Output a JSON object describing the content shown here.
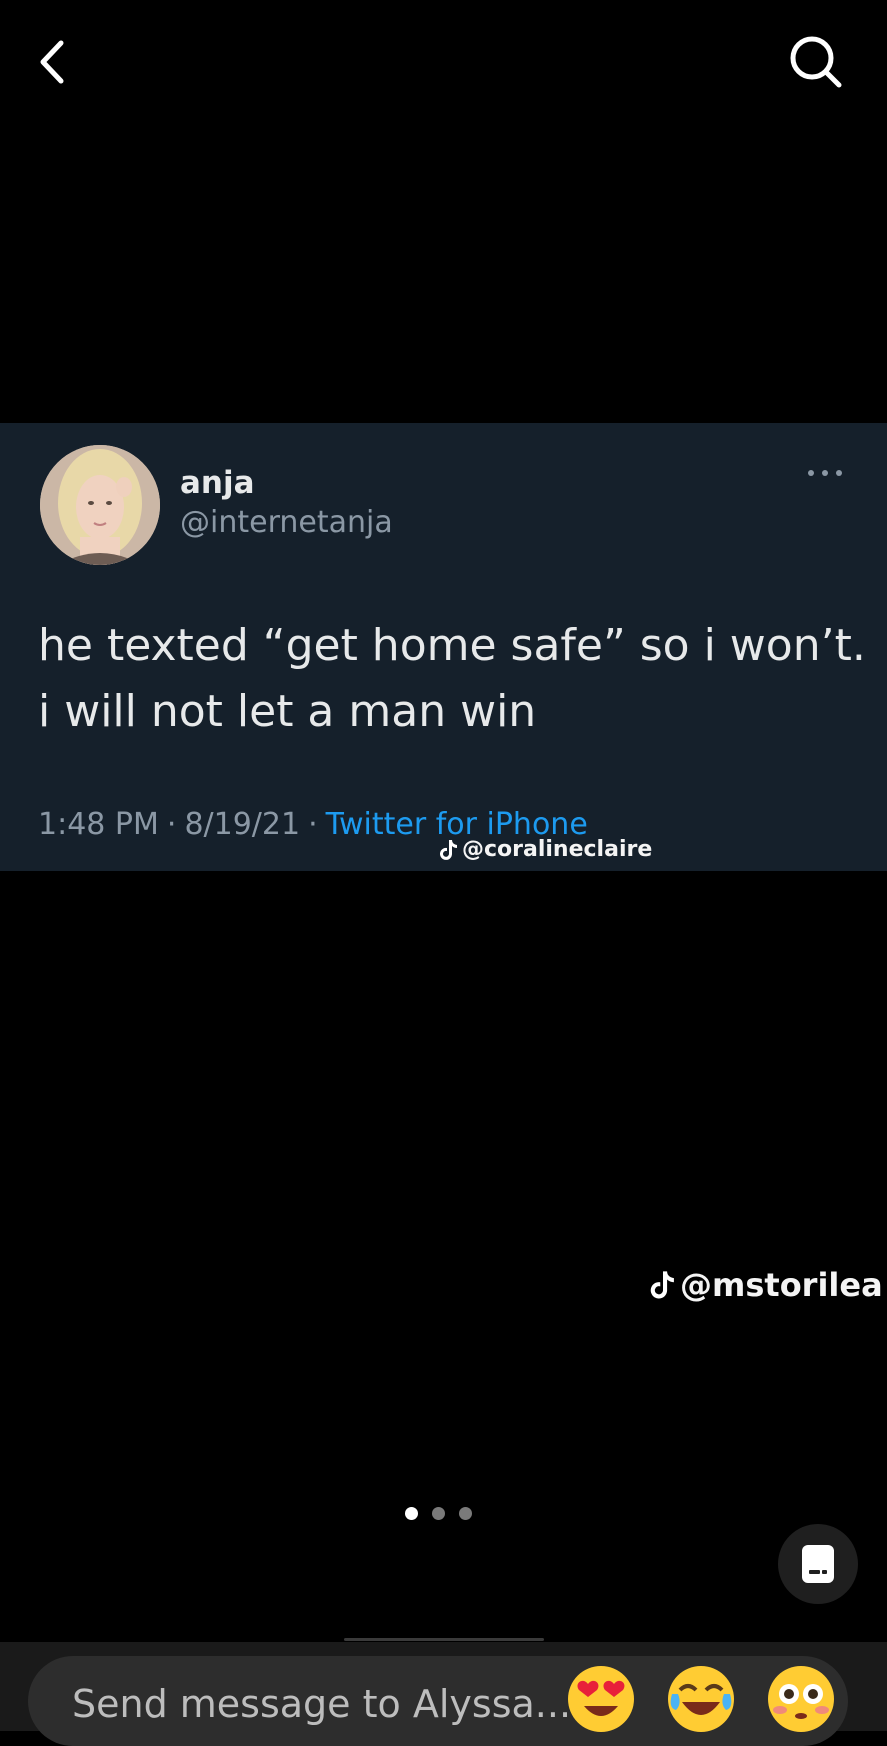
{
  "colors": {
    "background": "#000000",
    "tweet_background": "#15202b",
    "tweet_text": "#e7e9ea",
    "tweet_muted": "#8b98a5",
    "twitter_link": "#1d9bf0"
  },
  "nav": {
    "back_icon": "chevron-left-icon",
    "search_icon": "search-icon"
  },
  "tweet": {
    "name": "anja",
    "handle": "@internetanja",
    "text_lines": [
      "he texted “get home safe” so i won’t.",
      "i will not let a man win"
    ],
    "time": "1:48 PM",
    "date": "8/19/21",
    "source": "Twitter for iPhone",
    "separator": "·"
  },
  "watermarks": {
    "top": "@coralineclaire",
    "bottom": "@mstorilea"
  },
  "pagination": {
    "count": 3,
    "active": 0
  },
  "composer": {
    "placeholder": "Send message to Alyssa...",
    "reactions": [
      "heart-eyes-emoji",
      "tears-of-joy-emoji",
      "flushed-face-emoji"
    ]
  }
}
